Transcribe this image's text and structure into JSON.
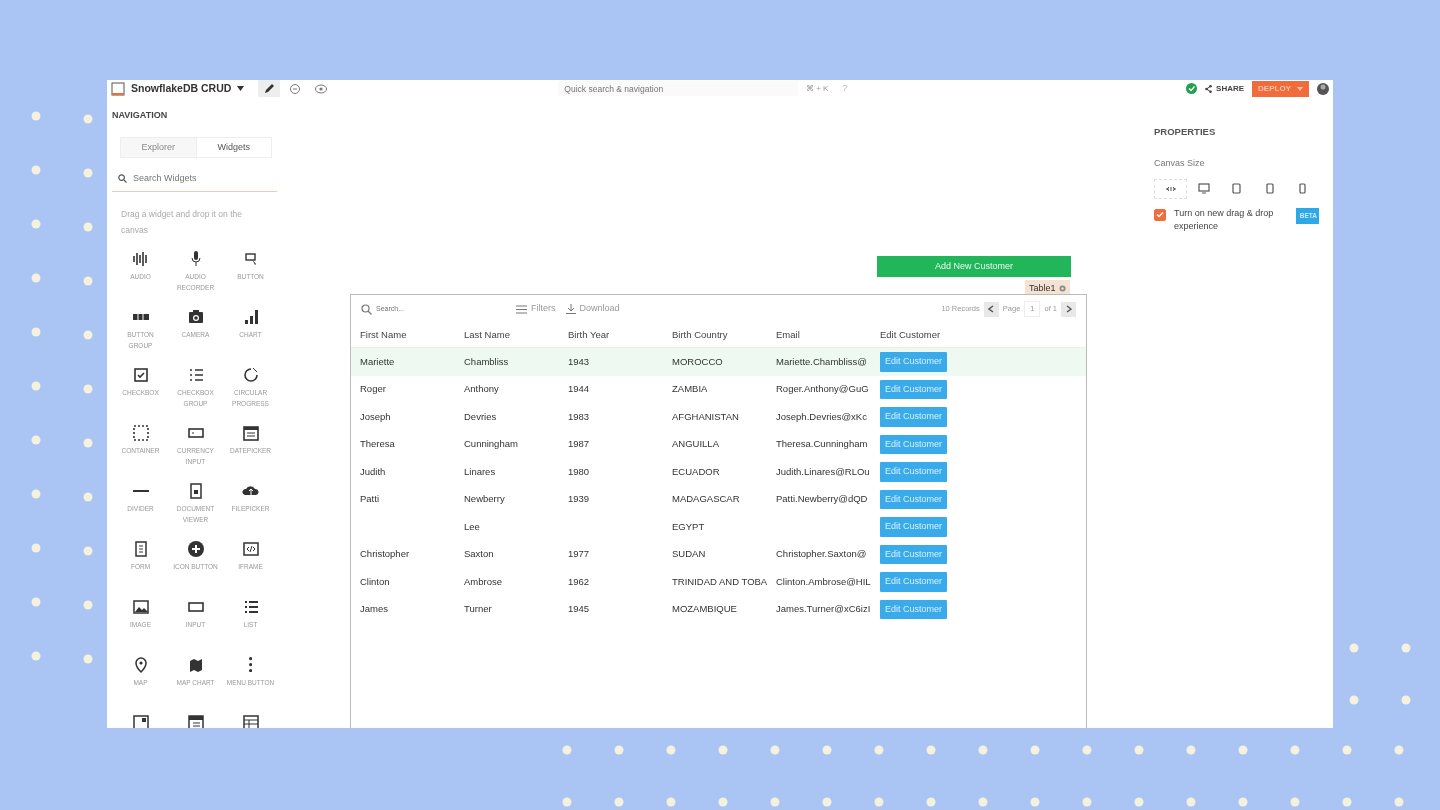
{
  "topbar": {
    "app_name": "SnowflakeDB CRUD",
    "modes": [
      {
        "selected": true
      },
      {
        "selected": false
      },
      {
        "selected": false
      }
    ],
    "search": {
      "placeholder": "Quick search & navigation",
      "shortcut": "⌘ + K"
    },
    "help": "?",
    "share": "SHARE",
    "deploy": "DEPLOY"
  },
  "sidebar": {
    "title": "NAVIGATION",
    "tabs": [
      {
        "label": "Explorer",
        "selected": false
      },
      {
        "label": "Widgets",
        "selected": true
      }
    ],
    "search": {
      "placeholder": "Search Widgets"
    },
    "hint": "Drag a widget and drop it on the canvas",
    "widgets": [
      {
        "kind": "widget",
        "label": "AUDIO"
      },
      {
        "kind": "widget",
        "label": "AUDIO RECORDER"
      },
      {
        "kind": "widget",
        "label": "BUTTON"
      },
      {
        "kind": "widget",
        "label": "BUTTON GROUP"
      },
      {
        "kind": "widget",
        "label": "CAMERA"
      },
      {
        "kind": "widget",
        "label": "CHART"
      },
      {
        "kind": "widget",
        "label": "CHECKBOX"
      },
      {
        "kind": "widget",
        "label": "CHECKBOX GROUP"
      },
      {
        "kind": "widget",
        "label": "CIRCULAR PROGRESS"
      },
      {
        "kind": "widget",
        "label": "CONTAINER"
      },
      {
        "kind": "widget",
        "label": "CURRENCY INPUT"
      },
      {
        "kind": "widget",
        "label": "DATEPICKER"
      },
      {
        "kind": "widget",
        "label": "DIVIDER"
      },
      {
        "kind": "widget",
        "label": "DOCUMENT VIEWER"
      },
      {
        "kind": "widget",
        "label": "FILEPICKER"
      },
      {
        "kind": "widget",
        "label": "FORM"
      },
      {
        "kind": "widget",
        "label": "ICON BUTTON"
      },
      {
        "kind": "widget",
        "label": "IFRAME"
      },
      {
        "kind": "widget",
        "label": "IMAGE"
      },
      {
        "kind": "widget",
        "label": "INPUT"
      },
      {
        "kind": "widget",
        "label": "LIST"
      },
      {
        "kind": "widget",
        "label": "MAP"
      },
      {
        "kind": "widget",
        "label": "MAP CHART"
      },
      {
        "kind": "widget",
        "label": "MENU BUTTON"
      },
      {
        "kind": "cut"
      },
      {
        "kind": "cut"
      },
      {
        "kind": "cut"
      }
    ]
  },
  "canvas": {
    "add_button": "Add New Customer",
    "table": {
      "name": "Table1",
      "search_placeholder": "Search...",
      "filters": "Filters",
      "download": "Download",
      "records": "10 Records",
      "page_label": "Page",
      "page": "1",
      "page_total": "of 1",
      "columns": [
        "First Name",
        "Last Name",
        "Birth Year",
        "Birth Country",
        "Email",
        "Edit Customer"
      ],
      "rows": [
        {
          "selected": true,
          "cells": [
            "Mariette",
            "Chambliss",
            "1943",
            "MOROCCO",
            "Mariette.Chambliss@"
          ],
          "action": "Edit Customer"
        },
        {
          "selected": false,
          "cells": [
            "Roger",
            "Anthony",
            "1944",
            "ZAMBIA",
            "Roger.Anthony@GuG"
          ],
          "action": "Edit Customer"
        },
        {
          "selected": false,
          "cells": [
            "Joseph",
            "Devries",
            "1983",
            "AFGHANISTAN",
            "Joseph.Devries@xKc"
          ],
          "action": "Edit Customer"
        },
        {
          "selected": false,
          "cells": [
            "Theresa",
            "Cunningham",
            "1987",
            "ANGUILLA",
            "Theresa.Cunningham"
          ],
          "action": "Edit Customer"
        },
        {
          "selected": false,
          "cells": [
            "Judith",
            "Linares",
            "1980",
            "ECUADOR",
            "Judith.Linares@RLOu"
          ],
          "action": "Edit Customer"
        },
        {
          "selected": false,
          "cells": [
            "Patti",
            "Newberry",
            "1939",
            "MADAGASCAR",
            "Patti.Newberry@dQD"
          ],
          "action": "Edit Customer"
        },
        {
          "selected": false,
          "cells": [
            null,
            "Lee",
            null,
            "EGYPT",
            null
          ],
          "action": "Edit Customer"
        },
        {
          "selected": false,
          "cells": [
            "Christopher",
            "Saxton",
            "1977",
            "SUDAN",
            "Christopher.Saxton@"
          ],
          "action": "Edit Customer"
        },
        {
          "selected": false,
          "cells": [
            "Clinton",
            "Ambrose",
            "1962",
            "TRINIDAD AND TOBA",
            "Clinton.Ambrose@HIL"
          ],
          "action": "Edit Customer"
        },
        {
          "selected": false,
          "cells": [
            "James",
            "Turner",
            "1945",
            "MOZAMBIQUE",
            "James.Turner@xC6izI"
          ],
          "action": "Edit Customer"
        }
      ]
    }
  },
  "properties": {
    "title": "PROPERTIES",
    "canvas_size_label": "Canvas Size",
    "sizes": [
      {
        "selected": true
      },
      {
        "selected": false
      },
      {
        "selected": false
      },
      {
        "selected": false
      },
      {
        "selected": false
      }
    ],
    "drag_drop": {
      "checked": true,
      "label": "Turn on new drag & drop experience",
      "badge": "BETA"
    }
  }
}
